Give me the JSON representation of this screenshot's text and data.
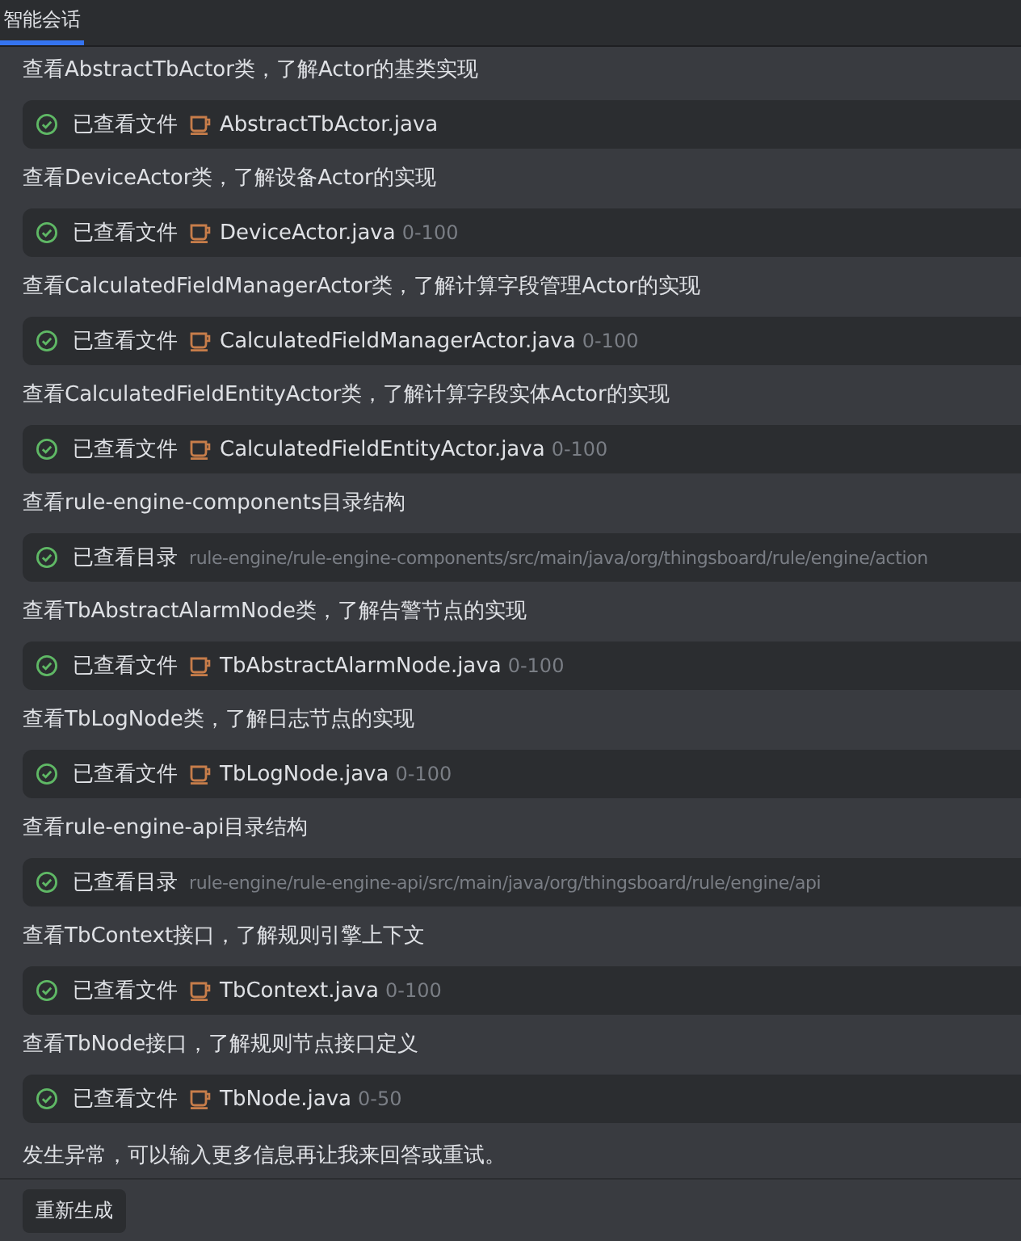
{
  "tabs": [
    {
      "label": "智能会话",
      "selected": true
    }
  ],
  "steps": [
    {
      "description": "查看AbstractTbActor类，了解Actor的基类实现",
      "result": {
        "kind": "file",
        "status": "已查看文件",
        "name": "AbstractTbActor.java"
      }
    },
    {
      "description": "查看DeviceActor类，了解设备Actor的实现",
      "result": {
        "kind": "file",
        "status": "已查看文件",
        "name": "DeviceActor.java",
        "range": "0-100"
      }
    },
    {
      "description": "查看CalculatedFieldManagerActor类，了解计算字段管理Actor的实现",
      "result": {
        "kind": "file",
        "status": "已查看文件",
        "name": "CalculatedFieldManagerActor.java",
        "range": "0-100"
      }
    },
    {
      "description": "查看CalculatedFieldEntityActor类，了解计算字段实体Actor的实现",
      "result": {
        "kind": "file",
        "status": "已查看文件",
        "name": "CalculatedFieldEntityActor.java",
        "range": "0-100"
      }
    },
    {
      "description": "查看rule-engine-components目录结构",
      "result": {
        "kind": "dir",
        "status": "已查看目录",
        "path": "rule-engine/rule-engine-components/src/main/java/org/thingsboard/rule/engine/action"
      }
    },
    {
      "description": "查看TbAbstractAlarmNode类，了解告警节点的实现",
      "result": {
        "kind": "file",
        "status": "已查看文件",
        "name": "TbAbstractAlarmNode.java",
        "range": "0-100"
      }
    },
    {
      "description": "查看TbLogNode类，了解日志节点的实现",
      "result": {
        "kind": "file",
        "status": "已查看文件",
        "name": "TbLogNode.java",
        "range": "0-100"
      }
    },
    {
      "description": "查看rule-engine-api目录结构",
      "result": {
        "kind": "dir",
        "status": "已查看目录",
        "path": "rule-engine/rule-engine-api/src/main/java/org/thingsboard/rule/engine/api"
      }
    },
    {
      "description": "查看TbContext接口，了解规则引擎上下文",
      "result": {
        "kind": "file",
        "status": "已查看文件",
        "name": "TbContext.java",
        "range": "0-100"
      }
    },
    {
      "description": "查看TbNode接口，了解规则节点接口定义",
      "result": {
        "kind": "file",
        "status": "已查看文件",
        "name": "TbNode.java",
        "range": "0-50"
      }
    }
  ],
  "error_message": "发生异常，可以输入更多信息再让我来回答或重试。",
  "regenerate_button": "重新生成"
}
